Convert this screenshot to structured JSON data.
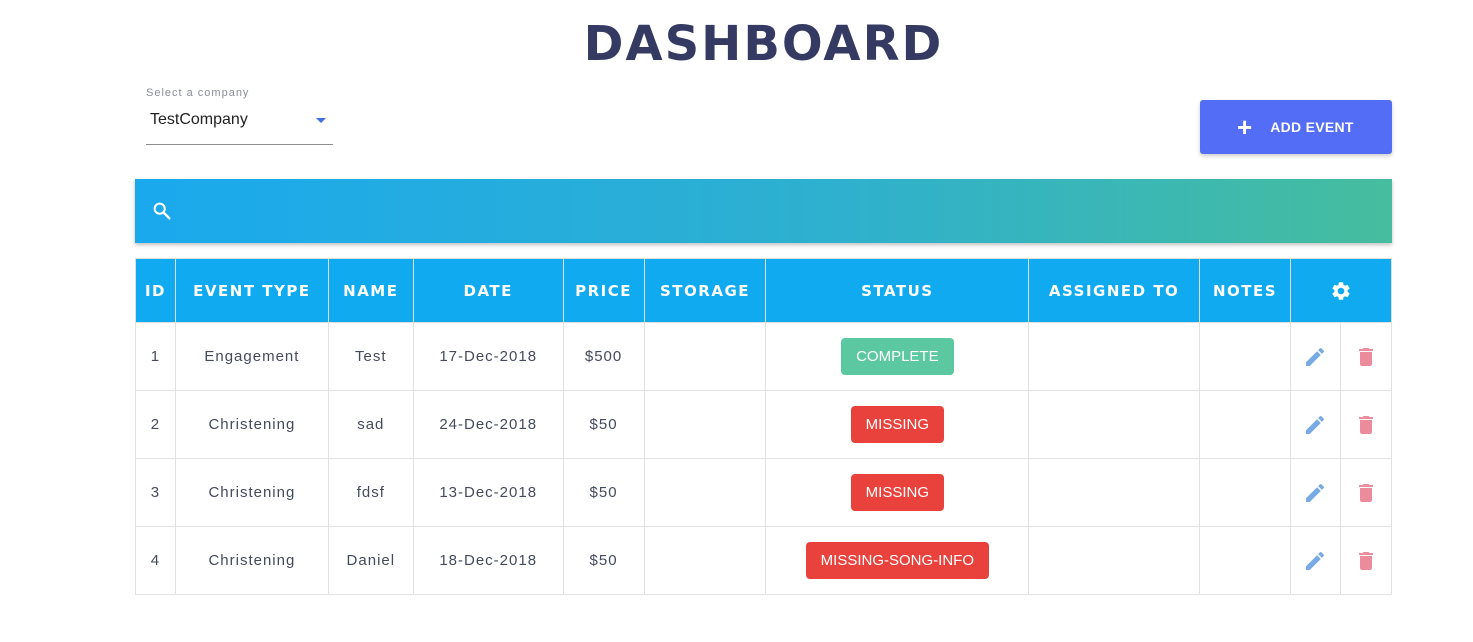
{
  "page": {
    "title": "DASHBOARD"
  },
  "company_select": {
    "label": "Select a company",
    "value": "TestCompany"
  },
  "add_event": {
    "label": "ADD EVENT",
    "icon": "plus-icon"
  },
  "search": {
    "placeholder": "",
    "icon": "search-icon"
  },
  "colors": {
    "header_bg": "#10aaf0",
    "button_bg": "#546df6",
    "title": "#353a63",
    "badge_complete": "#5cc8a2",
    "badge_missing": "#e9413b",
    "edit_icon": "#78abe2",
    "delete_icon": "#ec8b9b"
  },
  "table": {
    "headers": [
      "ID",
      "EVENT TYPE",
      "NAME",
      "DATE",
      "PRICE",
      "STORAGE",
      "STATUS",
      "ASSIGNED TO",
      "NOTES"
    ],
    "settings_icon": "gear-icon",
    "rows": [
      {
        "id": "1",
        "event_type": "Engagement",
        "name": "Test",
        "date": "17-Dec-2018",
        "price": "$500",
        "storage": "",
        "status": "COMPLETE",
        "status_kind": "complete",
        "assigned_to": "",
        "notes": ""
      },
      {
        "id": "2",
        "event_type": "Christening",
        "name": "sad",
        "date": "24-Dec-2018",
        "price": "$50",
        "storage": "",
        "status": "MISSING",
        "status_kind": "missing",
        "assigned_to": "",
        "notes": ""
      },
      {
        "id": "3",
        "event_type": "Christening",
        "name": "fdsf",
        "date": "13-Dec-2018",
        "price": "$50",
        "storage": "",
        "status": "MISSING",
        "status_kind": "missing",
        "assigned_to": "",
        "notes": ""
      },
      {
        "id": "4",
        "event_type": "Christening",
        "name": "Daniel",
        "date": "18-Dec-2018",
        "price": "$50",
        "storage": "",
        "status": "MISSING-SONG-INFO",
        "status_kind": "missing",
        "assigned_to": "",
        "notes": ""
      }
    ]
  }
}
